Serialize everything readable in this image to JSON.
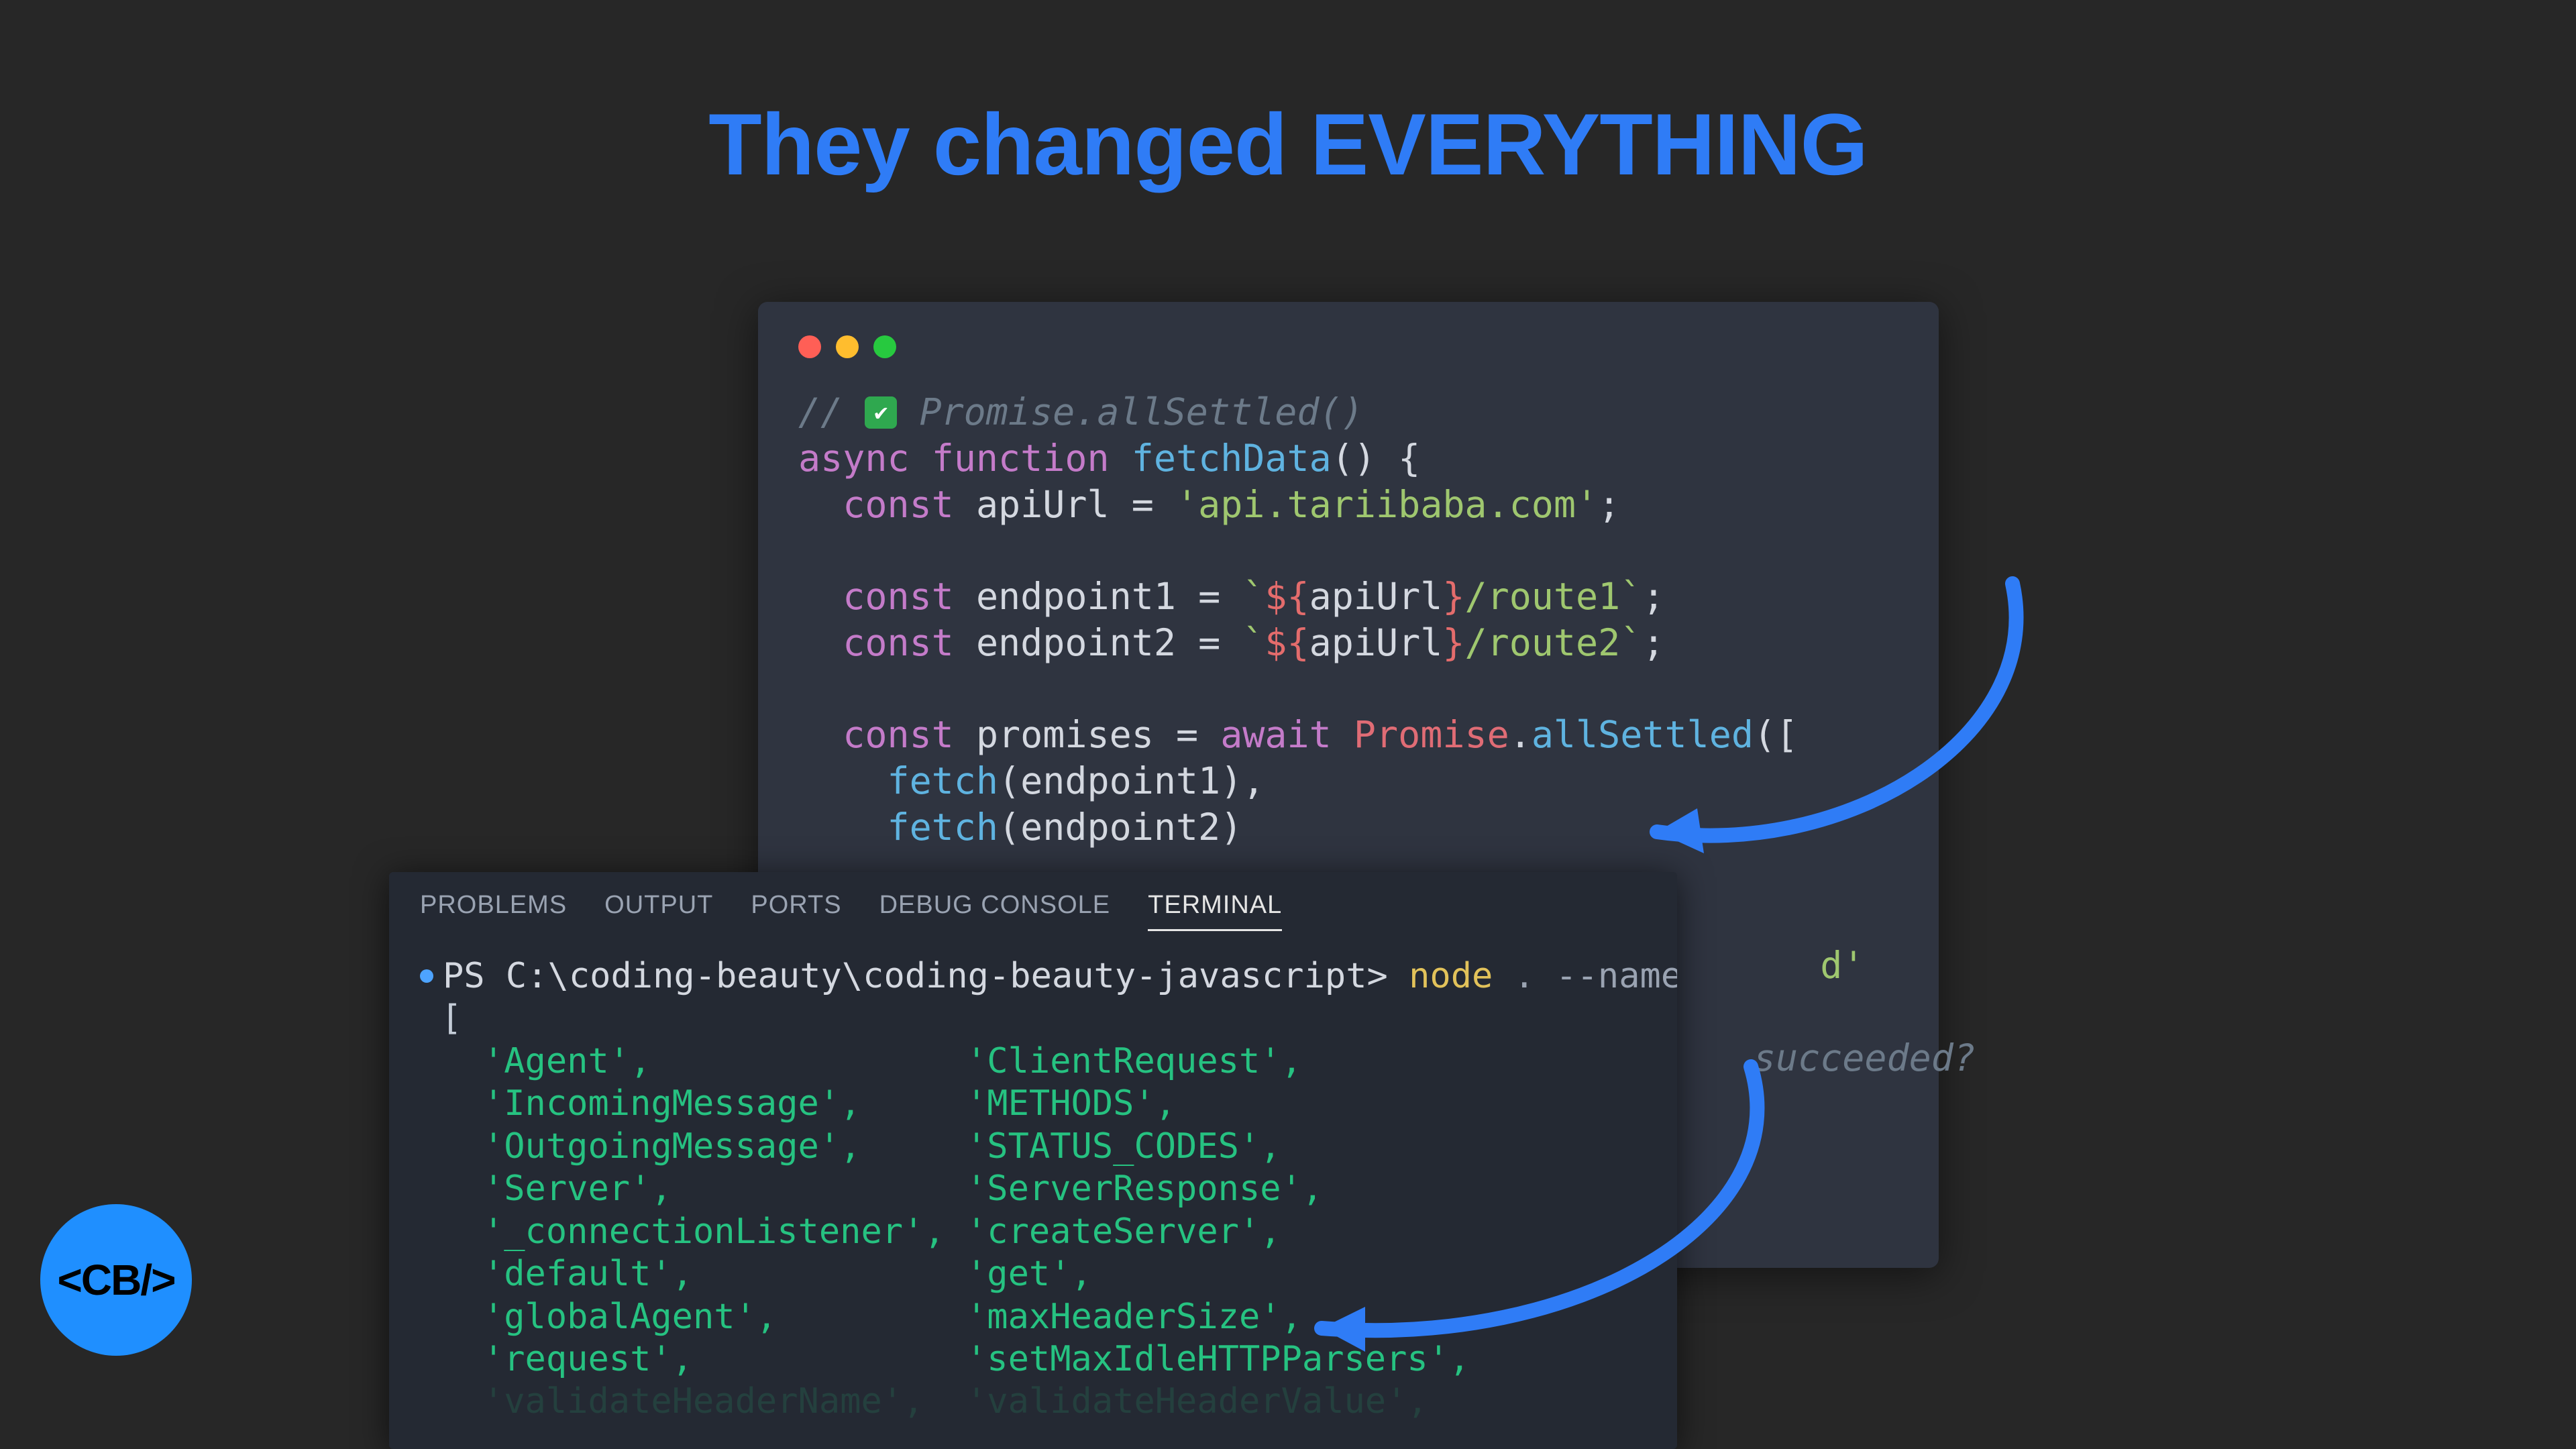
{
  "title": "They changed EVERYTHING",
  "logo": "<CB/>",
  "code": {
    "comment_prefix": "// ",
    "comment_text": " Promise.allSettled()",
    "line1_async": "async",
    "line1_function": "function",
    "line1_name": "fetchData",
    "line1_parens": "() {",
    "line2_const": "const",
    "line2_var": "apiUrl",
    "line2_eq": " = ",
    "line2_str": "'api.tariibaba.com'",
    "line2_semi": ";",
    "line3_const": "const",
    "line3_var": "endpoint1",
    "line3_eq": " = ",
    "line3_tick1": "`",
    "line3_interp_open": "${",
    "line3_interp_var": "apiUrl",
    "line3_interp_close": "}",
    "line3_rest": "/route1",
    "line3_tick2": "`",
    "line3_semi": ";",
    "line4_const": "const",
    "line4_var": "endpoint2",
    "line4_eq": " = ",
    "line4_tick1": "`",
    "line4_interp_open": "${",
    "line4_interp_var": "apiUrl",
    "line4_interp_close": "}",
    "line4_rest": "/route2",
    "line4_tick2": "`",
    "line4_semi": ";",
    "line5_const": "const",
    "line5_var": "promises",
    "line5_eq": " = ",
    "line5_await": "await",
    "line5_space": " ",
    "line5_promise": "Promise",
    "line5_dot": ".",
    "line5_method": "allSettled",
    "line5_open": "([",
    "line6_fetch": "fetch",
    "line6_arg": "(endpoint1),",
    "line7_fetch": "fetch",
    "line7_arg": "(endpoint2)",
    "obscured_d": "d'",
    "obscured_succeeded": "succeeded?"
  },
  "terminal": {
    "tabs": [
      "PROBLEMS",
      "OUTPUT",
      "PORTS",
      "DEBUG CONSOLE",
      "TERMINAL"
    ],
    "active_tab_index": 4,
    "prompt_prefix": "PS ",
    "prompt_path": "C:\\coding-beauty\\coding-beauty-javascript>",
    "prompt_cmd": " node",
    "prompt_args": " . --name=http",
    "open_bracket": "[",
    "rows": [
      [
        "'Agent'",
        "'ClientRequest'"
      ],
      [
        "'IncomingMessage'",
        "'METHODS'"
      ],
      [
        "'OutgoingMessage'",
        "'STATUS_CODES'"
      ],
      [
        "'Server'",
        "'ServerResponse'"
      ],
      [
        "'_connectionListener'",
        "'createServer'"
      ],
      [
        "'default'",
        "'get'"
      ],
      [
        "'globalAgent'",
        "'maxHeaderSize'"
      ],
      [
        "'request'",
        "'setMaxIdleHTTPParsers'"
      ]
    ],
    "cutoff_row_hint": [
      "'validateHeaderName'",
      "'validateHeaderValue'"
    ]
  },
  "colors": {
    "background": "#272727",
    "accent_blue": "#2F7CF6",
    "code_bg": "#2F3440",
    "terminal_bg": "#242933",
    "arrow": "#2F7CF6"
  }
}
